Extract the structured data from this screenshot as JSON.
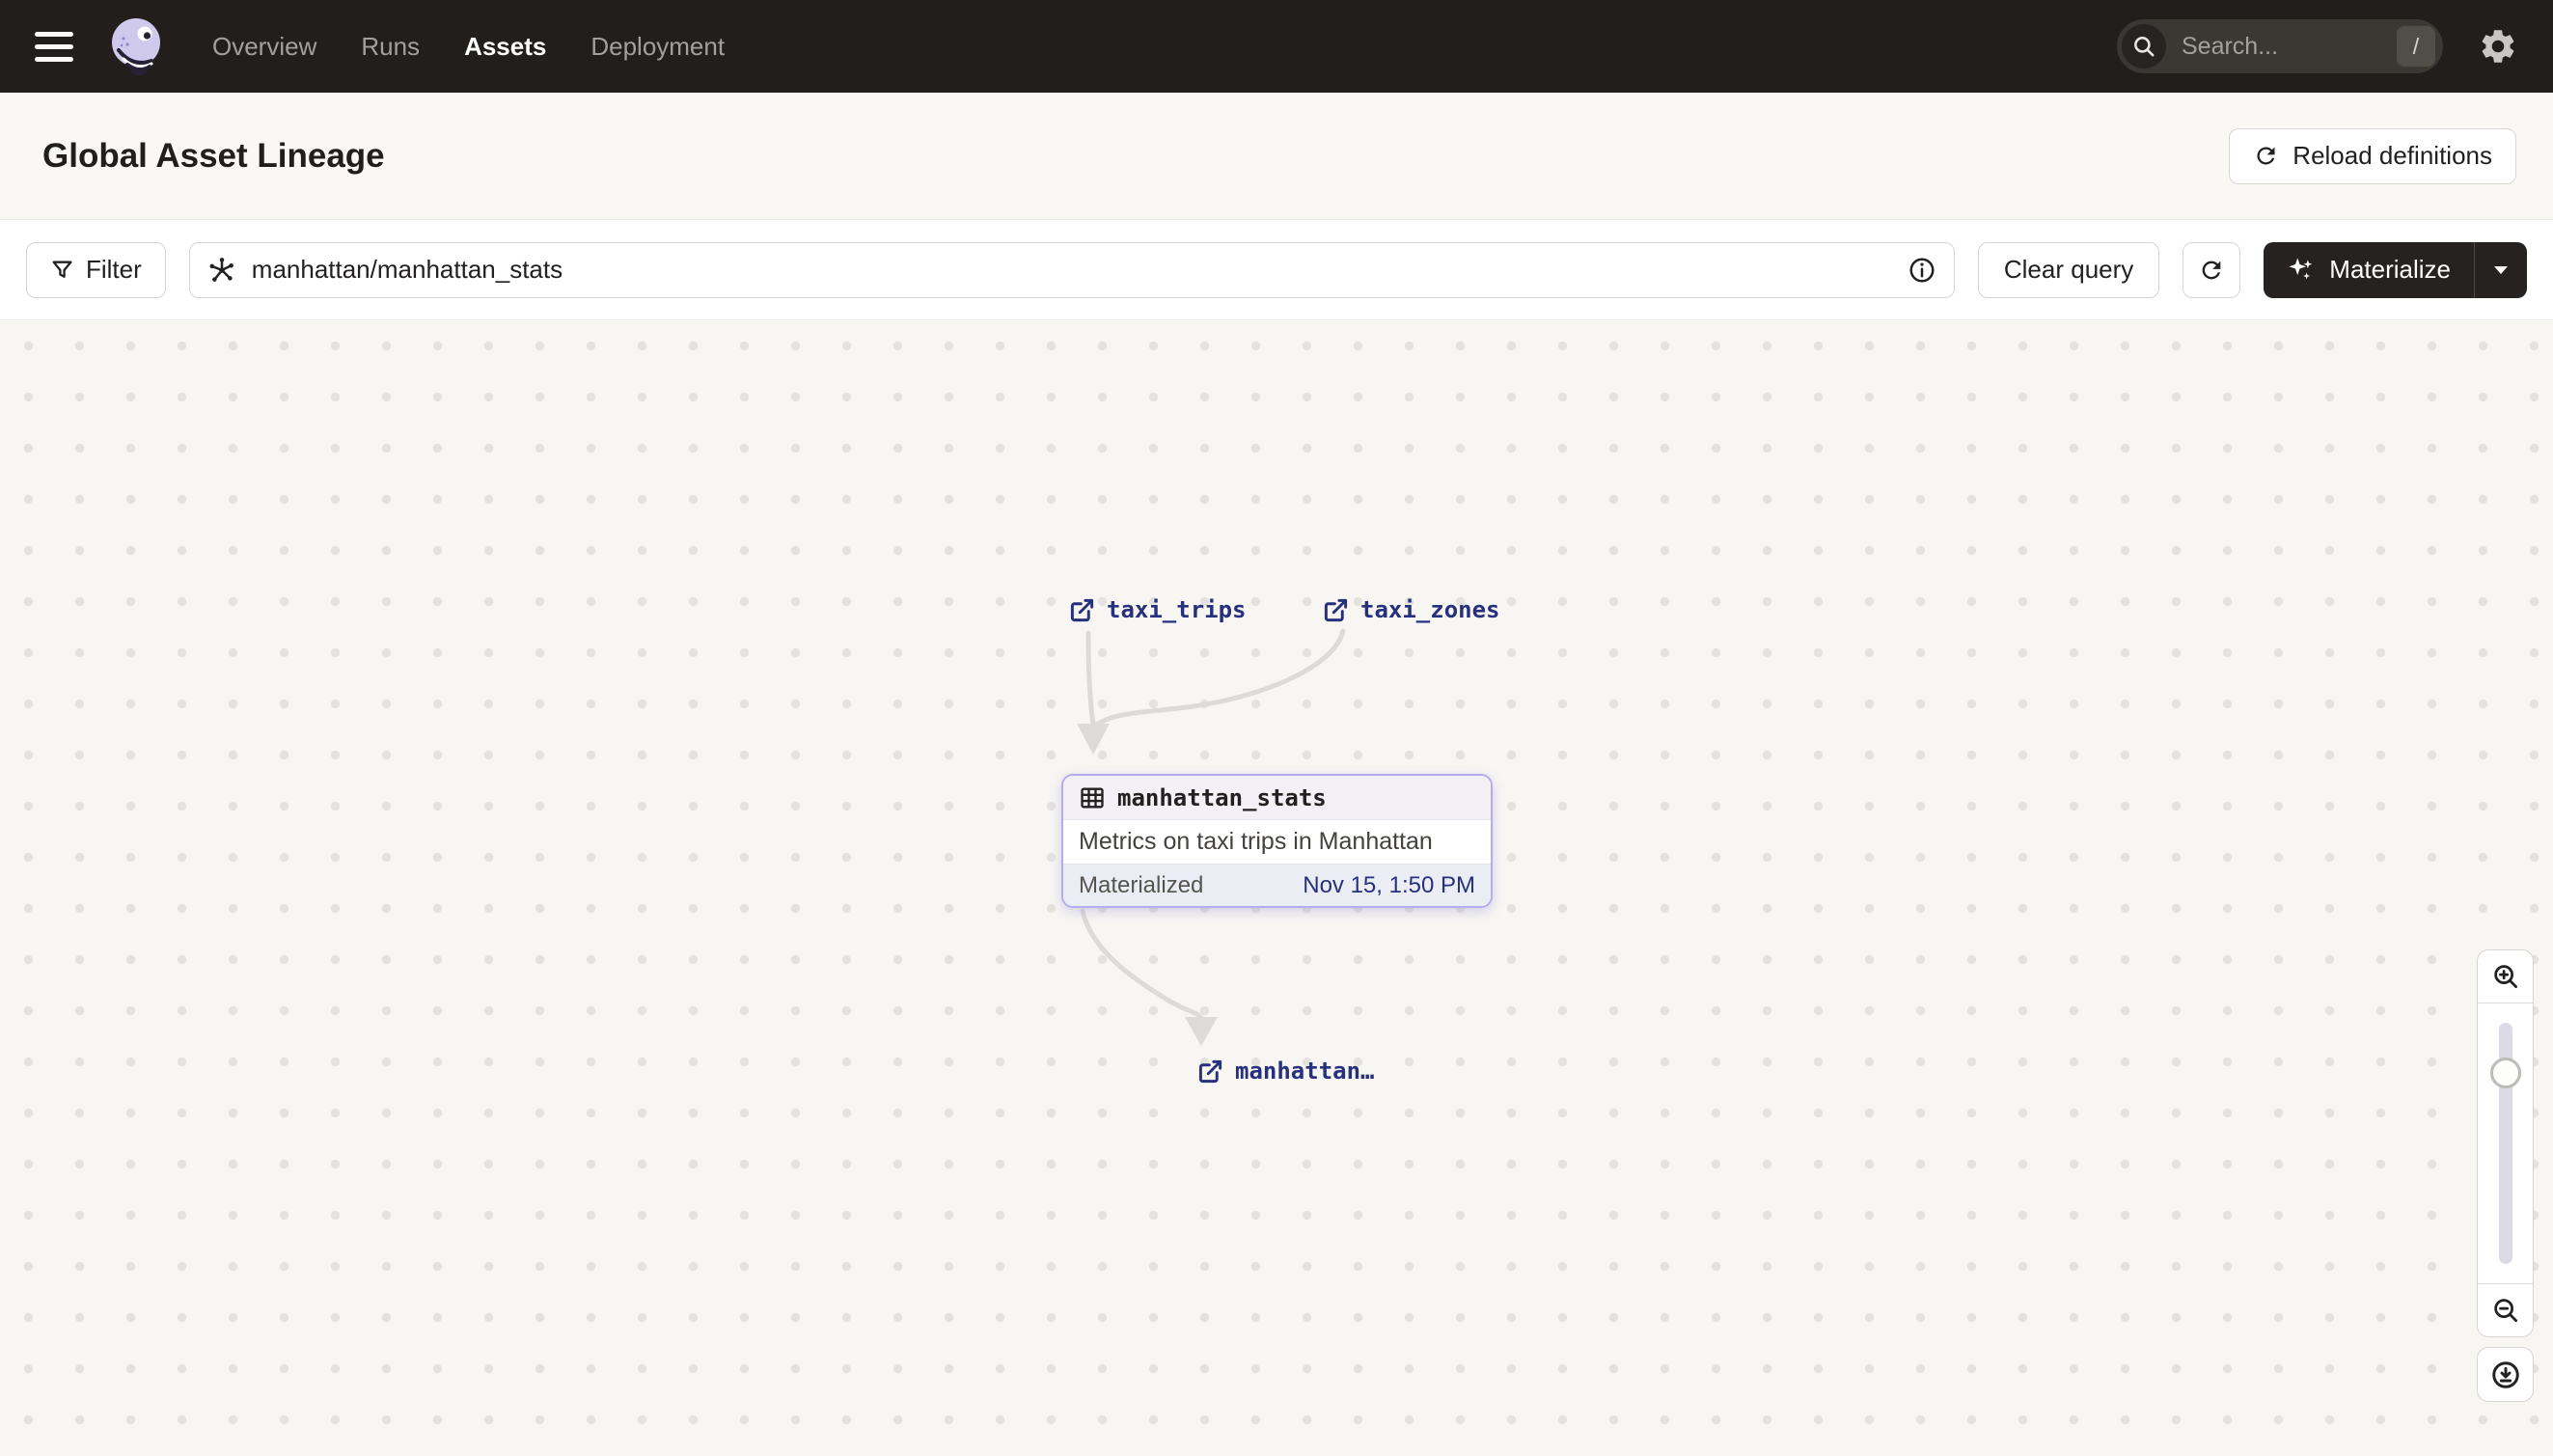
{
  "nav": {
    "links": [
      {
        "label": "Overview",
        "active": false
      },
      {
        "label": "Runs",
        "active": false
      },
      {
        "label": "Assets",
        "active": true
      },
      {
        "label": "Deployment",
        "active": false
      }
    ],
    "search": {
      "placeholder": "Search...",
      "shortcut": "/"
    }
  },
  "header": {
    "title": "Global Asset Lineage",
    "reload_label": "Reload definitions"
  },
  "toolbar": {
    "filter_label": "Filter",
    "query_value": "manhattan/manhattan_stats",
    "clear_label": "Clear query",
    "materialize_label": "Materialize"
  },
  "graph": {
    "upstream": [
      {
        "label": "taxi_trips"
      },
      {
        "label": "taxi_zones"
      }
    ],
    "selected": {
      "label": "manhattan_stats",
      "description": "Metrics on taxi trips in Manhattan",
      "status": "Materialized",
      "time": "Nov 15, 1:50 PM"
    },
    "downstream": [
      {
        "label": "manhattan…"
      }
    ]
  },
  "colors": {
    "nav_bg": "#221E1C",
    "selected_border": "#B5ABEF",
    "asset_link": "#27307C",
    "edge": "#DDDBD8",
    "canvas_bg": "#F7F6F3"
  }
}
